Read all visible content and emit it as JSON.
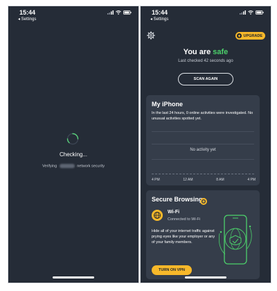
{
  "colors": {
    "background": "#252c37",
    "card": "#353d4a",
    "accent": "#f7b82a",
    "safe_green": "#4cd16b",
    "spinner_green": "#58d07a"
  },
  "left_screen": {
    "status": {
      "time": "15:44",
      "back": "◂ Settings"
    },
    "checking_label": "Checking...",
    "verifying_prefix": "Verifying",
    "verifying_suffix": "network security"
  },
  "right_screen": {
    "status": {
      "time": "15:44",
      "back": "◂ Settings"
    },
    "upgrade_label": "UPGRADE",
    "title_prefix": "You are ",
    "title_status": "safe",
    "last_checked": "Last checked 42 seconds ago",
    "scan_button": "SCAN AGAIN",
    "my_iphone": {
      "title": "My iPhone",
      "description": "In the last 24 hours, 0 online activities were investigated. No unusual activities spotted yet.",
      "no_activity": "No activity yet",
      "axis_labels": [
        "4 PM",
        "12 AM",
        "8 AM",
        "4 PM"
      ]
    },
    "secure_browsing": {
      "title": "Secure Browsing",
      "wifi_title": "Wi-Fi",
      "wifi_status": "Connected to Wi-Fi",
      "description": "Hide all of your internet traffic against prying eyes like your employer or any of your family members.",
      "vpn_button": "TURN ON VPN"
    }
  }
}
